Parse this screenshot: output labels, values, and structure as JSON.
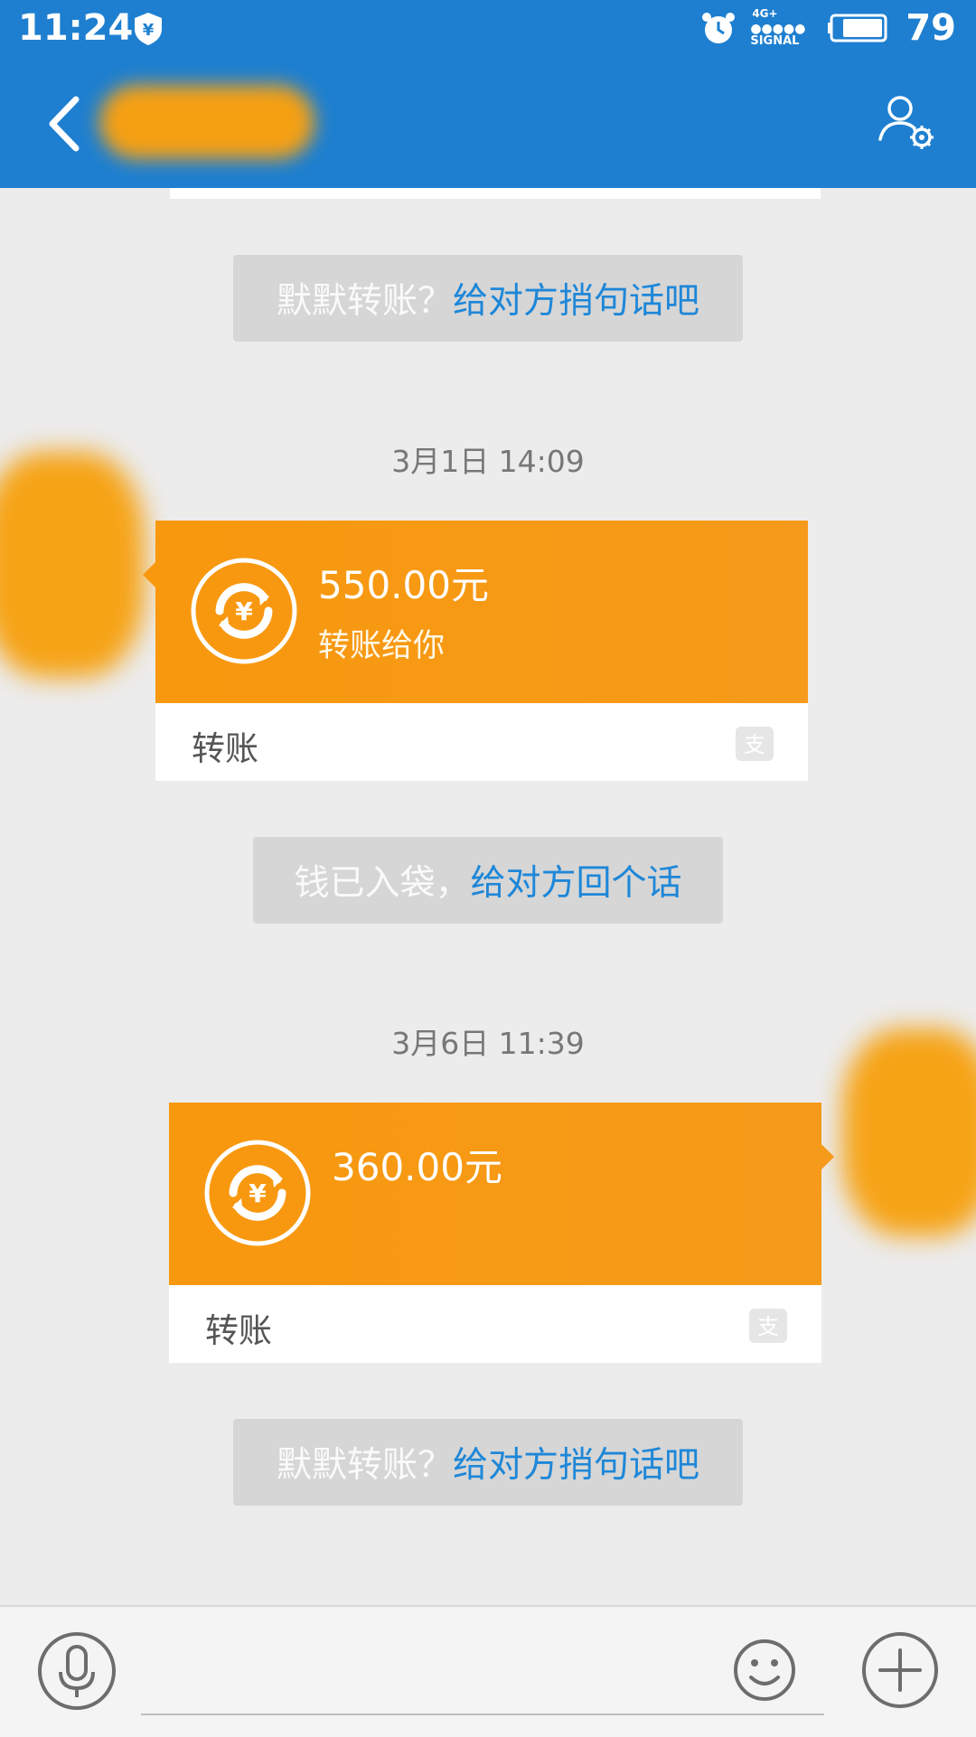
{
  "status_bar": {
    "time": "11:24",
    "network": "4G+",
    "signal_label": "SIGNAL",
    "battery_percent": "79"
  },
  "header": {
    "title": ""
  },
  "chat": {
    "messages": [
      {
        "type": "system",
        "text_gray": "默默转账？",
        "text_link": "给对方捎句话吧"
      },
      {
        "type": "timestamp",
        "text": "3月1日 14:09"
      },
      {
        "type": "transfer",
        "side": "left",
        "amount": "550.00元",
        "description": "转账给你",
        "label": "转账",
        "icon": "alipay-icon"
      },
      {
        "type": "system",
        "text_gray": "钱已入袋，",
        "text_link": "给对方回个话"
      },
      {
        "type": "timestamp",
        "text": "3月6日 11:39"
      },
      {
        "type": "transfer",
        "side": "right",
        "amount": "360.00元",
        "description": "",
        "label": "转账",
        "icon": "alipay-icon"
      },
      {
        "type": "system",
        "text_gray": "默默转账？",
        "text_link": "给对方捎句话吧"
      }
    ]
  },
  "input_bar": {
    "placeholder": ""
  },
  "colors": {
    "brand_blue": "#1e7fd0",
    "transfer_orange": "#f8980e",
    "link_blue": "#1e87d8",
    "chat_background": "#ececec"
  }
}
